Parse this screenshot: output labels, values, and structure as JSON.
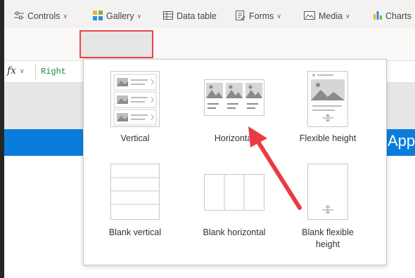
{
  "ribbon": {
    "controls_label": "Controls",
    "gallery_label": "Gallery",
    "datatable_label": "Data table",
    "forms_label": "Forms",
    "media_label": "Media",
    "charts_label": "Charts"
  },
  "formula_bar": {
    "fx_label": "fx",
    "value": "Right"
  },
  "app_bar": {
    "text": "App"
  },
  "gallery_menu": {
    "vertical": "Vertical",
    "horizontal": "Horizontal",
    "flexible_height": "Flexible height",
    "blank_vertical": "Blank vertical",
    "blank_horizontal": "Blank horizontal",
    "blank_flexible_line1": "Blank flexible",
    "blank_flexible_line2": "height"
  },
  "colors": {
    "highlight": "#e84449",
    "app_bar": "#0a7ddc",
    "formula_value": "#1e8a3a"
  }
}
